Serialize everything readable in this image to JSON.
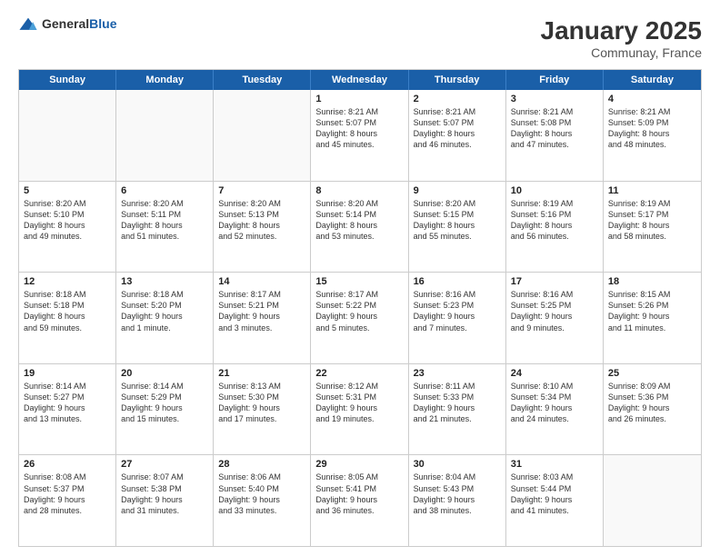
{
  "logo": {
    "general": "General",
    "blue": "Blue"
  },
  "title": "January 2025",
  "subtitle": "Communay, France",
  "days": [
    "Sunday",
    "Monday",
    "Tuesday",
    "Wednesday",
    "Thursday",
    "Friday",
    "Saturday"
  ],
  "weeks": [
    [
      {
        "day": "",
        "content": ""
      },
      {
        "day": "",
        "content": ""
      },
      {
        "day": "",
        "content": ""
      },
      {
        "day": "1",
        "content": "Sunrise: 8:21 AM\nSunset: 5:07 PM\nDaylight: 8 hours\nand 45 minutes."
      },
      {
        "day": "2",
        "content": "Sunrise: 8:21 AM\nSunset: 5:07 PM\nDaylight: 8 hours\nand 46 minutes."
      },
      {
        "day": "3",
        "content": "Sunrise: 8:21 AM\nSunset: 5:08 PM\nDaylight: 8 hours\nand 47 minutes."
      },
      {
        "day": "4",
        "content": "Sunrise: 8:21 AM\nSunset: 5:09 PM\nDaylight: 8 hours\nand 48 minutes."
      }
    ],
    [
      {
        "day": "5",
        "content": "Sunrise: 8:20 AM\nSunset: 5:10 PM\nDaylight: 8 hours\nand 49 minutes."
      },
      {
        "day": "6",
        "content": "Sunrise: 8:20 AM\nSunset: 5:11 PM\nDaylight: 8 hours\nand 51 minutes."
      },
      {
        "day": "7",
        "content": "Sunrise: 8:20 AM\nSunset: 5:13 PM\nDaylight: 8 hours\nand 52 minutes."
      },
      {
        "day": "8",
        "content": "Sunrise: 8:20 AM\nSunset: 5:14 PM\nDaylight: 8 hours\nand 53 minutes."
      },
      {
        "day": "9",
        "content": "Sunrise: 8:20 AM\nSunset: 5:15 PM\nDaylight: 8 hours\nand 55 minutes."
      },
      {
        "day": "10",
        "content": "Sunrise: 8:19 AM\nSunset: 5:16 PM\nDaylight: 8 hours\nand 56 minutes."
      },
      {
        "day": "11",
        "content": "Sunrise: 8:19 AM\nSunset: 5:17 PM\nDaylight: 8 hours\nand 58 minutes."
      }
    ],
    [
      {
        "day": "12",
        "content": "Sunrise: 8:18 AM\nSunset: 5:18 PM\nDaylight: 8 hours\nand 59 minutes."
      },
      {
        "day": "13",
        "content": "Sunrise: 8:18 AM\nSunset: 5:20 PM\nDaylight: 9 hours\nand 1 minute."
      },
      {
        "day": "14",
        "content": "Sunrise: 8:17 AM\nSunset: 5:21 PM\nDaylight: 9 hours\nand 3 minutes."
      },
      {
        "day": "15",
        "content": "Sunrise: 8:17 AM\nSunset: 5:22 PM\nDaylight: 9 hours\nand 5 minutes."
      },
      {
        "day": "16",
        "content": "Sunrise: 8:16 AM\nSunset: 5:23 PM\nDaylight: 9 hours\nand 7 minutes."
      },
      {
        "day": "17",
        "content": "Sunrise: 8:16 AM\nSunset: 5:25 PM\nDaylight: 9 hours\nand 9 minutes."
      },
      {
        "day": "18",
        "content": "Sunrise: 8:15 AM\nSunset: 5:26 PM\nDaylight: 9 hours\nand 11 minutes."
      }
    ],
    [
      {
        "day": "19",
        "content": "Sunrise: 8:14 AM\nSunset: 5:27 PM\nDaylight: 9 hours\nand 13 minutes."
      },
      {
        "day": "20",
        "content": "Sunrise: 8:14 AM\nSunset: 5:29 PM\nDaylight: 9 hours\nand 15 minutes."
      },
      {
        "day": "21",
        "content": "Sunrise: 8:13 AM\nSunset: 5:30 PM\nDaylight: 9 hours\nand 17 minutes."
      },
      {
        "day": "22",
        "content": "Sunrise: 8:12 AM\nSunset: 5:31 PM\nDaylight: 9 hours\nand 19 minutes."
      },
      {
        "day": "23",
        "content": "Sunrise: 8:11 AM\nSunset: 5:33 PM\nDaylight: 9 hours\nand 21 minutes."
      },
      {
        "day": "24",
        "content": "Sunrise: 8:10 AM\nSunset: 5:34 PM\nDaylight: 9 hours\nand 24 minutes."
      },
      {
        "day": "25",
        "content": "Sunrise: 8:09 AM\nSunset: 5:36 PM\nDaylight: 9 hours\nand 26 minutes."
      }
    ],
    [
      {
        "day": "26",
        "content": "Sunrise: 8:08 AM\nSunset: 5:37 PM\nDaylight: 9 hours\nand 28 minutes."
      },
      {
        "day": "27",
        "content": "Sunrise: 8:07 AM\nSunset: 5:38 PM\nDaylight: 9 hours\nand 31 minutes."
      },
      {
        "day": "28",
        "content": "Sunrise: 8:06 AM\nSunset: 5:40 PM\nDaylight: 9 hours\nand 33 minutes."
      },
      {
        "day": "29",
        "content": "Sunrise: 8:05 AM\nSunset: 5:41 PM\nDaylight: 9 hours\nand 36 minutes."
      },
      {
        "day": "30",
        "content": "Sunrise: 8:04 AM\nSunset: 5:43 PM\nDaylight: 9 hours\nand 38 minutes."
      },
      {
        "day": "31",
        "content": "Sunrise: 8:03 AM\nSunset: 5:44 PM\nDaylight: 9 hours\nand 41 minutes."
      },
      {
        "day": "",
        "content": ""
      }
    ]
  ]
}
